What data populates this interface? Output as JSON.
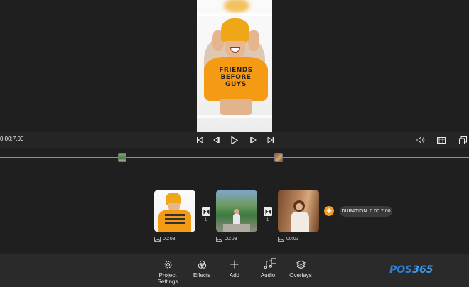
{
  "player": {
    "time_display": "0:00:7.00",
    "preview_shirt_text": [
      "FRIENDS",
      "BEFORE",
      "GUYS"
    ]
  },
  "storyboard": {
    "clips": [
      {
        "duration": "00:03"
      },
      {
        "duration": "00:03"
      },
      {
        "duration": "00:03"
      }
    ],
    "transitions": [
      {
        "count": "1"
      },
      {
        "count": "1"
      }
    ],
    "total_duration": "DURATION: 0:00:7.00"
  },
  "toolbar": {
    "project_settings": "Project Settings",
    "effects": "Effects",
    "add": "Add",
    "audio": "Audio",
    "audio_badge": "1",
    "overlays": "Overlays"
  },
  "watermark": {
    "brand": "POS",
    "number": "365"
  },
  "icons": {
    "prev": "skip-previous-icon",
    "back_frame": "step-back-icon",
    "play": "play-icon",
    "fwd_frame": "step-forward-icon",
    "next": "skip-next-icon",
    "volume": "volume-icon",
    "aspect": "aspect-ratio-icon",
    "fullscreen": "fullscreen-icon",
    "transition": "transition-icon",
    "image": "image-icon",
    "gear": "gear-icon",
    "effects": "effects-icon",
    "add": "plus-icon",
    "audio": "music-note-icon",
    "overlays": "layers-icon"
  },
  "colors": {
    "accent": "#f79a1e",
    "toolbar_bg": "#2a2a2a",
    "app_bg": "#1f1f1f"
  }
}
